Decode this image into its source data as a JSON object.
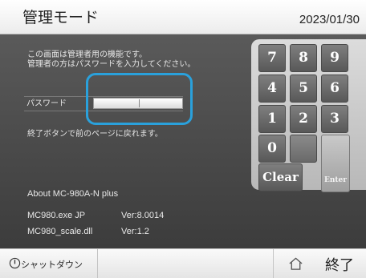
{
  "header": {
    "title": "管理モード",
    "date": "2023/01/30"
  },
  "main": {
    "message_line1": "この画面は管理者用の機能です。",
    "message_line2": "管理者の方はパスワードを入力してください。",
    "password_label": "パスワード",
    "password_value": "",
    "end_message": "終了ボタンで前のページに戻れます。",
    "about": "About MC-980A-N plus",
    "files": [
      {
        "name": "MC980.exe JP",
        "version": "Ver:8.0014"
      },
      {
        "name": "MC980_scale.dll",
        "version": "Ver:1.2"
      }
    ]
  },
  "keypad": {
    "keys": [
      "7",
      "8",
      "9",
      "4",
      "5",
      "6",
      "1",
      "2",
      "3",
      "0"
    ],
    "clear_label": "Clear",
    "enter_label": "Enter"
  },
  "footer": {
    "shutdown_label": "シャットダウン",
    "end_label": "終了"
  },
  "colors": {
    "highlight": "#2aa1dc",
    "panel": "#4a4a4a",
    "key": "#6b6b6b"
  },
  "icons": {
    "shutdown": "power-icon",
    "end": "home-icon"
  }
}
